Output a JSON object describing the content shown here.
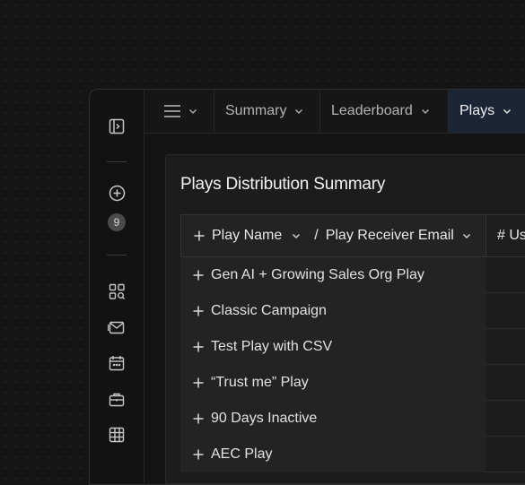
{
  "tabs": [
    {
      "label": "Summary"
    },
    {
      "label": "Leaderboard"
    },
    {
      "label": "Plays"
    }
  ],
  "rail": {
    "badge_count": "9"
  },
  "panel": {
    "title": "Plays Distribution Summary",
    "headers": {
      "play_name": "Play Name",
      "separator": "/",
      "receiver_email": "Play Receiver Email",
      "users_col": "# Us"
    },
    "rows": [
      {
        "label": "Gen AI + Growing Sales Org Play"
      },
      {
        "label": "Classic Campaign"
      },
      {
        "label": "Test Play with CSV"
      },
      {
        "label": "“Trust me” Play"
      },
      {
        "label": "90 Days Inactive"
      },
      {
        "label": "AEC Play"
      }
    ]
  },
  "colors": {
    "active_tab_bg": "#1b2536",
    "background": "#151515"
  }
}
